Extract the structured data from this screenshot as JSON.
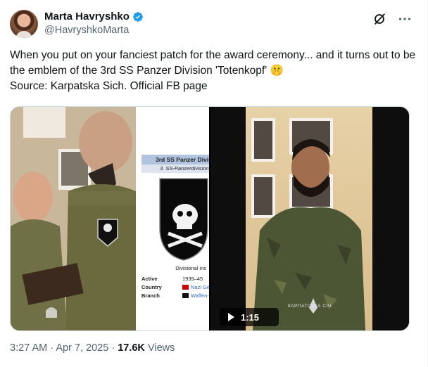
{
  "author": {
    "name": "Marta Havryshko",
    "handle": "@HavryshkoMarta",
    "verified_icon": "verified-badge-icon",
    "avatar_icon": "avatar"
  },
  "header_icons": [
    "grok-icon",
    "more-options-icon"
  ],
  "tweet": {
    "text": "When you put on your fanciest patch for the award ceremony... and it turns out to be the emblem of the 3rd SS Panzer Division 'Totenkopf' 🤫\nSource: Karpatska Sich. Official FB page"
  },
  "media": {
    "wiki": {
      "title": "3rd SS Panzer Divisi",
      "subtitle": "3. SS-Panzerdivision",
      "caption": "Divisional ins",
      "rows": [
        {
          "key": "Active",
          "value": "1939–45"
        },
        {
          "key": "Country",
          "value": "Nazi Ger"
        },
        {
          "key": "Branch",
          "value": "Waffen-S"
        }
      ]
    },
    "video": {
      "duration": "1:15",
      "watermark": "КАРПАТСЬКА СІЧ"
    }
  },
  "footer": {
    "time": "3:27 AM",
    "separator": "·",
    "date": "Apr 7, 2025",
    "views_count": "17.6K",
    "views_label": "Views"
  },
  "colors": {
    "verified": "#1d9bf0",
    "secondary_text": "#536471",
    "primary_text": "#0f1419"
  }
}
